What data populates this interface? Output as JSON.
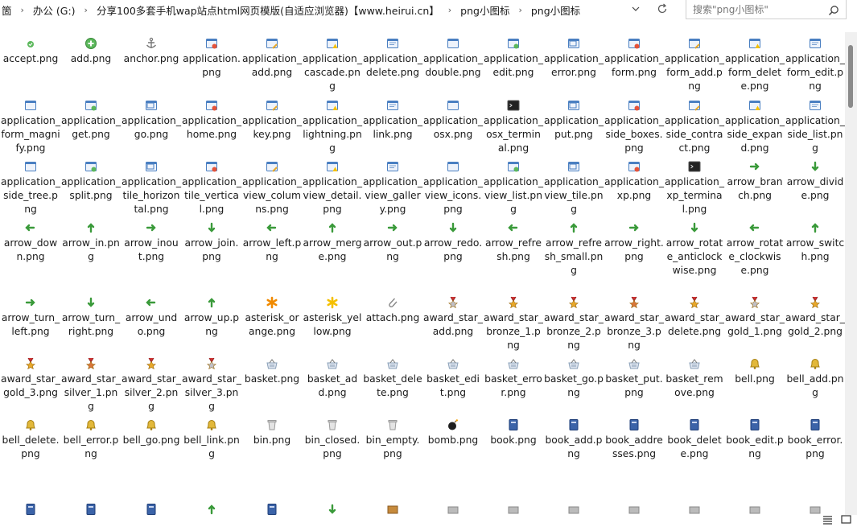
{
  "breadcrumb": {
    "items": [
      "箇",
      "办公 (G:)",
      "分享100多套手机wap站点html网页模版(自适应浏览器)【www.heirui.cn】",
      "png小图标",
      "png小图标"
    ],
    "separator": "›"
  },
  "search": {
    "placeholder": "搜索\"png小图标\""
  },
  "files": [
    {
      "name": "accept.png",
      "icon": "accept-icon"
    },
    {
      "name": "add.png",
      "icon": "add-icon"
    },
    {
      "name": "anchor.png",
      "icon": "anchor-icon"
    },
    {
      "name": "application.png",
      "icon": "window-icon"
    },
    {
      "name": "application_add.png",
      "icon": "window-icon"
    },
    {
      "name": "application_cascade.png",
      "icon": "window-icon"
    },
    {
      "name": "application_delete.png",
      "icon": "window-icon"
    },
    {
      "name": "application_double.png",
      "icon": "window-icon"
    },
    {
      "name": "application_edit.png",
      "icon": "window-icon"
    },
    {
      "name": "application_error.png",
      "icon": "window-icon"
    },
    {
      "name": "application_form.png",
      "icon": "window-icon"
    },
    {
      "name": "application_form_add.png",
      "icon": "window-icon"
    },
    {
      "name": "application_form_delete.png",
      "icon": "window-icon"
    },
    {
      "name": "application_form_edit.png",
      "icon": "window-icon"
    },
    {
      "name": "application_form_magnify.png",
      "icon": "window-icon"
    },
    {
      "name": "application_get.png",
      "icon": "window-icon"
    },
    {
      "name": "application_go.png",
      "icon": "window-icon"
    },
    {
      "name": "application_home.png",
      "icon": "window-icon"
    },
    {
      "name": "application_key.png",
      "icon": "window-icon"
    },
    {
      "name": "application_lightning.png",
      "icon": "window-icon"
    },
    {
      "name": "application_link.png",
      "icon": "window-icon"
    },
    {
      "name": "application_osx.png",
      "icon": "window-icon"
    },
    {
      "name": "application_osx_terminal.png",
      "icon": "terminal-icon"
    },
    {
      "name": "application_put.png",
      "icon": "window-icon"
    },
    {
      "name": "application_side_boxes.png",
      "icon": "window-icon"
    },
    {
      "name": "application_side_contract.png",
      "icon": "window-icon"
    },
    {
      "name": "application_side_expand.png",
      "icon": "window-icon"
    },
    {
      "name": "application_side_list.png",
      "icon": "window-icon"
    },
    {
      "name": "application_side_tree.png",
      "icon": "window-icon"
    },
    {
      "name": "application_split.png",
      "icon": "window-icon"
    },
    {
      "name": "application_tile_horizontal.png",
      "icon": "window-icon"
    },
    {
      "name": "application_tile_vertical.png",
      "icon": "window-icon"
    },
    {
      "name": "application_view_columns.png",
      "icon": "window-icon"
    },
    {
      "name": "application_view_detail.png",
      "icon": "window-icon"
    },
    {
      "name": "application_view_gallery.png",
      "icon": "window-icon"
    },
    {
      "name": "application_view_icons.png",
      "icon": "window-icon"
    },
    {
      "name": "application_view_list.png",
      "icon": "window-icon"
    },
    {
      "name": "application_view_tile.png",
      "icon": "window-icon"
    },
    {
      "name": "application_xp.png",
      "icon": "window-icon"
    },
    {
      "name": "application_xp_terminal.png",
      "icon": "terminal-icon"
    },
    {
      "name": "arrow_branch.png",
      "icon": "arrow-icon"
    },
    {
      "name": "arrow_divide.png",
      "icon": "arrow-icon"
    },
    {
      "name": "arrow_down.png",
      "icon": "arrow-icon"
    },
    {
      "name": "arrow_in.png",
      "icon": "arrow-icon"
    },
    {
      "name": "arrow_inout.png",
      "icon": "arrow-icon"
    },
    {
      "name": "arrow_join.png",
      "icon": "arrow-icon"
    },
    {
      "name": "arrow_left.png",
      "icon": "arrow-icon"
    },
    {
      "name": "arrow_merge.png",
      "icon": "arrow-icon"
    },
    {
      "name": "arrow_out.png",
      "icon": "arrow-icon"
    },
    {
      "name": "arrow_redo.png",
      "icon": "arrow-icon"
    },
    {
      "name": "arrow_refresh.png",
      "icon": "arrow-icon"
    },
    {
      "name": "arrow_refresh_small.png",
      "icon": "arrow-icon"
    },
    {
      "name": "arrow_right.png",
      "icon": "arrow-icon"
    },
    {
      "name": "arrow_rotate_anticlockwise.png",
      "icon": "arrow-icon"
    },
    {
      "name": "arrow_rotate_clockwise.png",
      "icon": "arrow-icon"
    },
    {
      "name": "arrow_switch.png",
      "icon": "arrow-icon"
    },
    {
      "name": "arrow_turn_left.png",
      "icon": "arrow-icon"
    },
    {
      "name": "arrow_turn_right.png",
      "icon": "arrow-icon"
    },
    {
      "name": "arrow_undo.png",
      "icon": "arrow-icon"
    },
    {
      "name": "arrow_up.png",
      "icon": "arrow-icon"
    },
    {
      "name": "asterisk_orange.png",
      "icon": "asterisk-icon"
    },
    {
      "name": "asterisk_yellow.png",
      "icon": "asterisk-icon"
    },
    {
      "name": "attach.png",
      "icon": "paperclip-icon"
    },
    {
      "name": "award_star_add.png",
      "icon": "award-icon"
    },
    {
      "name": "award_star_bronze_1.png",
      "icon": "award-icon"
    },
    {
      "name": "award_star_bronze_2.png",
      "icon": "award-icon"
    },
    {
      "name": "award_star_bronze_3.png",
      "icon": "award-icon"
    },
    {
      "name": "award_star_delete.png",
      "icon": "award-icon"
    },
    {
      "name": "award_star_gold_1.png",
      "icon": "award-icon"
    },
    {
      "name": "award_star_gold_2.png",
      "icon": "award-icon"
    },
    {
      "name": "award_star_gold_3.png",
      "icon": "award-icon"
    },
    {
      "name": "award_star_silver_1.png",
      "icon": "award-icon"
    },
    {
      "name": "award_star_silver_2.png",
      "icon": "award-icon"
    },
    {
      "name": "award_star_silver_3.png",
      "icon": "award-icon"
    },
    {
      "name": "basket.png",
      "icon": "basket-icon"
    },
    {
      "name": "basket_add.png",
      "icon": "basket-icon"
    },
    {
      "name": "basket_delete.png",
      "icon": "basket-icon"
    },
    {
      "name": "basket_edit.png",
      "icon": "basket-icon"
    },
    {
      "name": "basket_error.png",
      "icon": "basket-icon"
    },
    {
      "name": "basket_go.png",
      "icon": "basket-icon"
    },
    {
      "name": "basket_put.png",
      "icon": "basket-icon"
    },
    {
      "name": "basket_remove.png",
      "icon": "basket-icon"
    },
    {
      "name": "bell.png",
      "icon": "bell-icon"
    },
    {
      "name": "bell_add.png",
      "icon": "bell-icon"
    },
    {
      "name": "bell_delete.png",
      "icon": "bell-icon"
    },
    {
      "name": "bell_error.png",
      "icon": "bell-icon"
    },
    {
      "name": "bell_go.png",
      "icon": "bell-icon"
    },
    {
      "name": "bell_link.png",
      "icon": "bell-icon"
    },
    {
      "name": "bin.png",
      "icon": "bin-icon"
    },
    {
      "name": "bin_closed.png",
      "icon": "bin-icon"
    },
    {
      "name": "bin_empty.png",
      "icon": "bin-icon"
    },
    {
      "name": "bomb.png",
      "icon": "bomb-icon"
    },
    {
      "name": "book.png",
      "icon": "book-icon"
    },
    {
      "name": "book_add.png",
      "icon": "book-icon"
    },
    {
      "name": "book_addresses.png",
      "icon": "book-icon"
    },
    {
      "name": "book_delete.png",
      "icon": "book-icon"
    },
    {
      "name": "book_edit.png",
      "icon": "book-icon"
    },
    {
      "name": "book_error.png",
      "icon": "book-icon"
    }
  ],
  "partial_row_icons": [
    "book-icon",
    "book-icon",
    "book-icon",
    "arrow-icon",
    "book-icon",
    "arrow-icon",
    "box-icon",
    "bricks-icon",
    "bricks-icon",
    "bricks-icon",
    "bricks-icon",
    "bricks-icon",
    "bricks-icon",
    "bricks-icon"
  ],
  "colors": {
    "window": "#4a7fc1",
    "arrow": "#3a9a3a",
    "award": "#e8a82a",
    "basket": "#8aa0b8",
    "bell": "#e2b83a",
    "book": "#3b63a8",
    "bin": "#9a9a9a"
  }
}
